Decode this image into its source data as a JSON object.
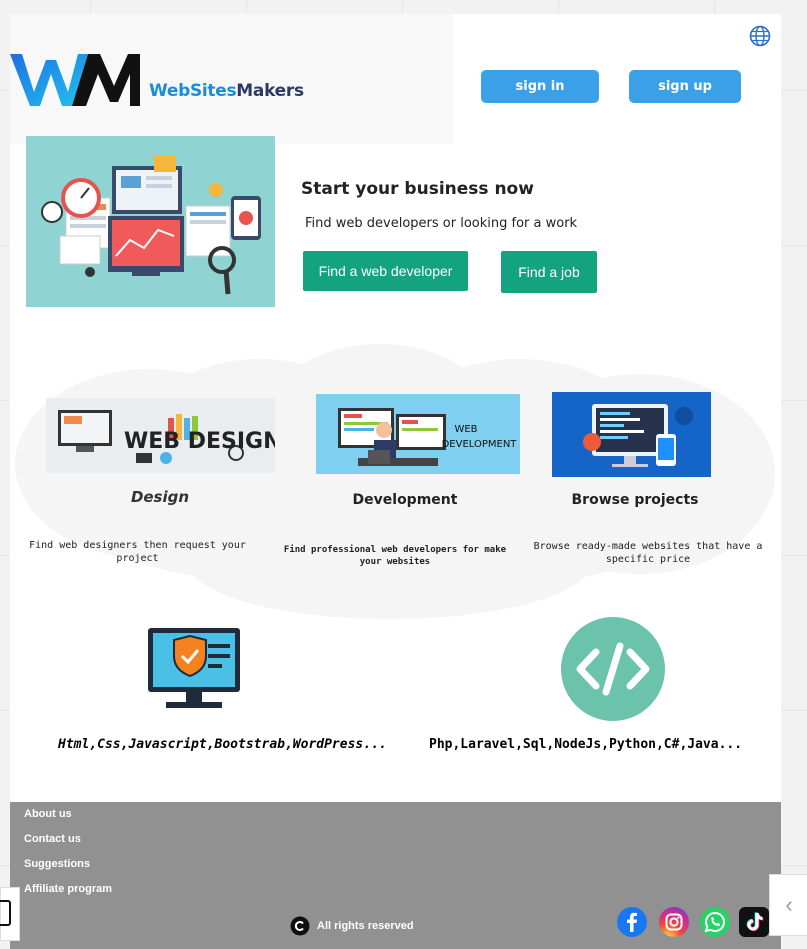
{
  "header": {
    "brand_part1": "WebSites",
    "brand_part2": "Makers",
    "logo_letters": "WM",
    "signin_label": "sign in",
    "signup_label": "sign up"
  },
  "hero": {
    "title": "Start your business now",
    "subtitle": "Find web developers or looking for a work",
    "find_dev_label": "Find a web developer",
    "find_job_label": "Find a job"
  },
  "services": [
    {
      "image_text": "WEB DESIGN",
      "title": "Design",
      "desc_line1": "Find web designers then request your",
      "desc_line2": "project"
    },
    {
      "image_text_line1": "WEB",
      "image_text_line2": "DEVELOPMENT",
      "title": "Development",
      "desc_line1": "Find professional web developers for make",
      "desc_line2": "your websites"
    },
    {
      "title": "Browse projects",
      "desc_line1": "Browse ready-made websites that have a",
      "desc_line2": "specific price"
    }
  ],
  "tech": {
    "frontend": "Html,Css,Javascript,Bootstrab,WordPress...",
    "backend": "Php,Laravel,Sql,NodeJs,Python,C#,Java..."
  },
  "footer": {
    "links": [
      "About us",
      "Contact us",
      "Suggestions",
      "Affiliate program"
    ],
    "rights": "All rights reserved",
    "social": [
      "facebook-icon",
      "instagram-icon",
      "whatsapp-icon",
      "tiktok-icon"
    ]
  },
  "colors": {
    "auth_button": "#3aa1e8",
    "green_button": "#14a37f",
    "footer": "#919191",
    "brand_blue": "#1a8cdb",
    "brand_navy": "#2b3b63"
  }
}
